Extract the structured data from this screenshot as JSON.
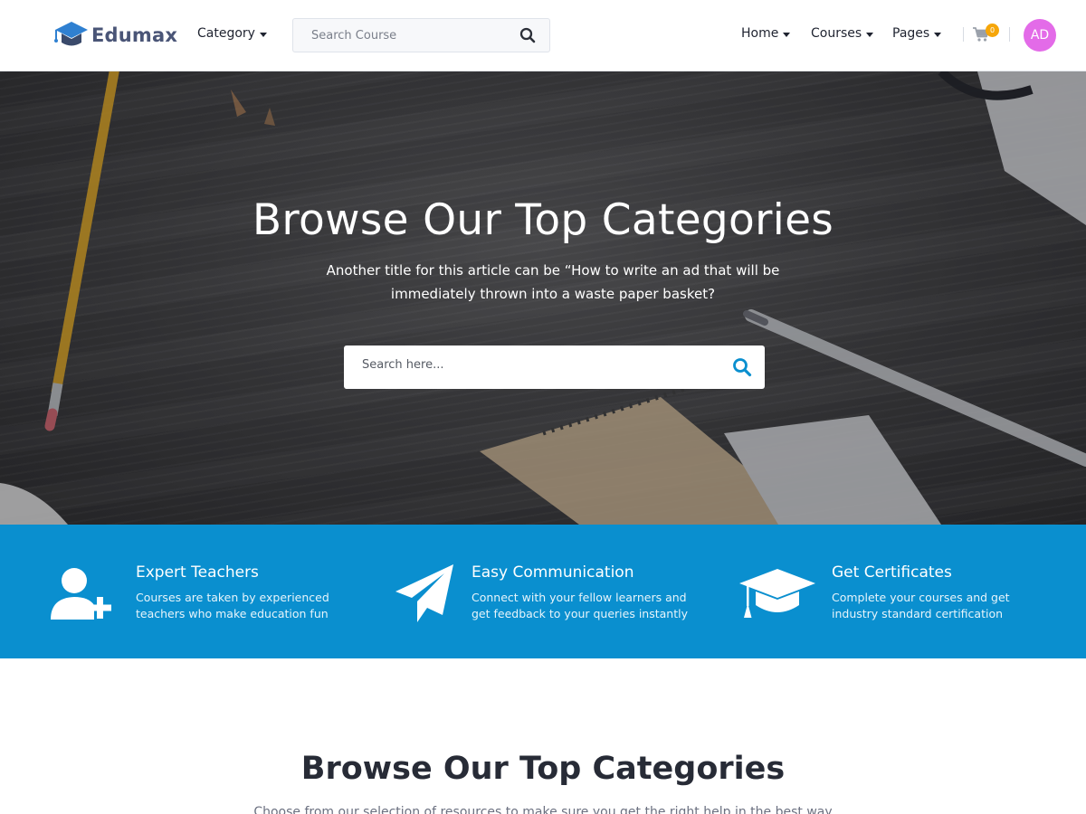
{
  "header": {
    "logo_text": "Edumax",
    "category_label": "Category",
    "search_placeholder": "Search Course",
    "nav": [
      {
        "label": "Home"
      },
      {
        "label": "Courses"
      },
      {
        "label": "Pages"
      }
    ],
    "cart_count": "0",
    "avatar_initials": "AD"
  },
  "hero": {
    "title": "Browse Our Top Categories",
    "subtitle": "Another title for this article can be “How to write an ad that will be immediately thrown into a waste paper basket?",
    "search_placeholder": "Search here..."
  },
  "features": [
    {
      "icon": "user-plus-icon",
      "title": "Expert Teachers",
      "desc": "Courses are taken by experienced teachers who make education fun"
    },
    {
      "icon": "paper-plane-icon",
      "title": "Easy Communication",
      "desc": "Connect with your fellow learners and get feedback to your queries instantly"
    },
    {
      "icon": "graduation-cap-icon",
      "title": "Get Certificates",
      "desc": "Complete your courses and get industry standard certification"
    }
  ],
  "section": {
    "title": "Browse Our Top Categories",
    "subtitle": "Choose from our selection of resources to make sure you get the right help in the best way"
  },
  "colors": {
    "brand_blue": "#0a8fcf",
    "avatar": "#e36be8",
    "badge": "#f6a609",
    "logo_text": "#4a5577"
  }
}
